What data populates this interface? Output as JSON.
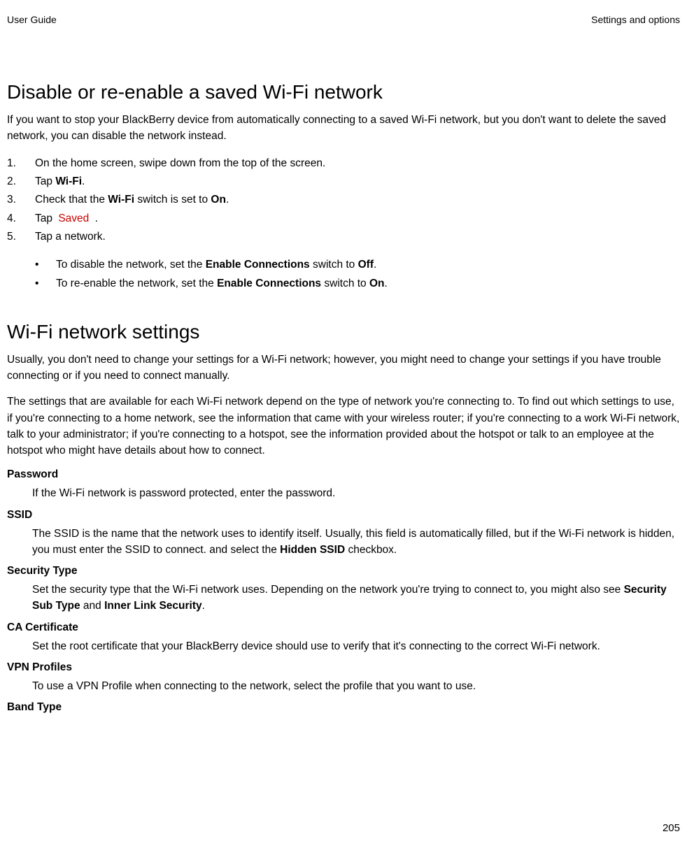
{
  "header": {
    "left": "User Guide",
    "right": "Settings and options"
  },
  "section1": {
    "title": "Disable or re-enable a saved Wi-Fi network",
    "intro": "If you want to stop your BlackBerry device from automatically connecting to a saved Wi-Fi network, but you don't want to delete the saved network, you can disable the network instead.",
    "steps": {
      "s1": {
        "num": "1.",
        "text": "On the home screen, swipe down from the top of the screen."
      },
      "s2": {
        "num": "2.",
        "pre": "Tap ",
        "bold": "Wi-Fi",
        "post": "."
      },
      "s3": {
        "num": "3.",
        "pre": "Check that the ",
        "bold1": "Wi-Fi",
        "mid": " switch is set to ",
        "bold2": "On",
        "post": "."
      },
      "s4": {
        "num": "4.",
        "pre": "Tap ",
        "link": " Saved ",
        "post": "."
      },
      "s5": {
        "num": "5.",
        "text": "Tap a network."
      }
    },
    "bullets": {
      "b1": {
        "pre": "To disable the network, set the ",
        "bold1": "Enable Connections",
        "mid": " switch to ",
        "bold2": "Off",
        "post": "."
      },
      "b2": {
        "pre": "To re-enable the network, set the ",
        "bold1": "Enable Connections",
        "mid": " switch to ",
        "bold2": "On",
        "post": "."
      }
    }
  },
  "section2": {
    "title": "Wi-Fi network settings",
    "p1": "Usually, you don't need to change your settings for a Wi-Fi network; however, you might need to change your settings if you have trouble connecting or if you need to connect manually.",
    "p2": "The settings that are available for each Wi-Fi network depend on the type of network you're connecting to. To find out which settings to use, if you're connecting to a home network, see the information that came with your wireless router; if you're connecting to a work Wi-Fi network, talk to your administrator; if you're connecting to a hotspot, see the information provided about the hotspot or talk to an employee at the hotspot who might have details about how to connect.",
    "defs": {
      "password": {
        "term": "Password",
        "desc": "If the Wi-Fi network is password protected, enter the password."
      },
      "ssid": {
        "term": "SSID",
        "desc_pre": "The SSID is the name that the network uses to identify itself. Usually, this field is automatically filled, but if the Wi-Fi network is hidden, you must enter the SSID to connect. and select the ",
        "desc_bold": "Hidden SSID",
        "desc_post": " checkbox."
      },
      "security": {
        "term": "Security Type",
        "desc_pre": "Set the security type that the Wi-Fi network uses. Depending on the network you're trying to connect to, you might also see ",
        "bold1": "Security Sub Type",
        "mid": " and ",
        "bold2": "Inner Link Security",
        "post": "."
      },
      "ca": {
        "term": "CA Certificate",
        "desc": "Set the root certificate that your BlackBerry device should use to verify that it's connecting to the correct Wi-Fi network."
      },
      "vpn": {
        "term": "VPN Profiles",
        "desc": "To use a VPN Profile when connecting to the network, select the profile that you want to use."
      },
      "band": {
        "term": "Band Type"
      }
    }
  },
  "pageNumber": "205"
}
